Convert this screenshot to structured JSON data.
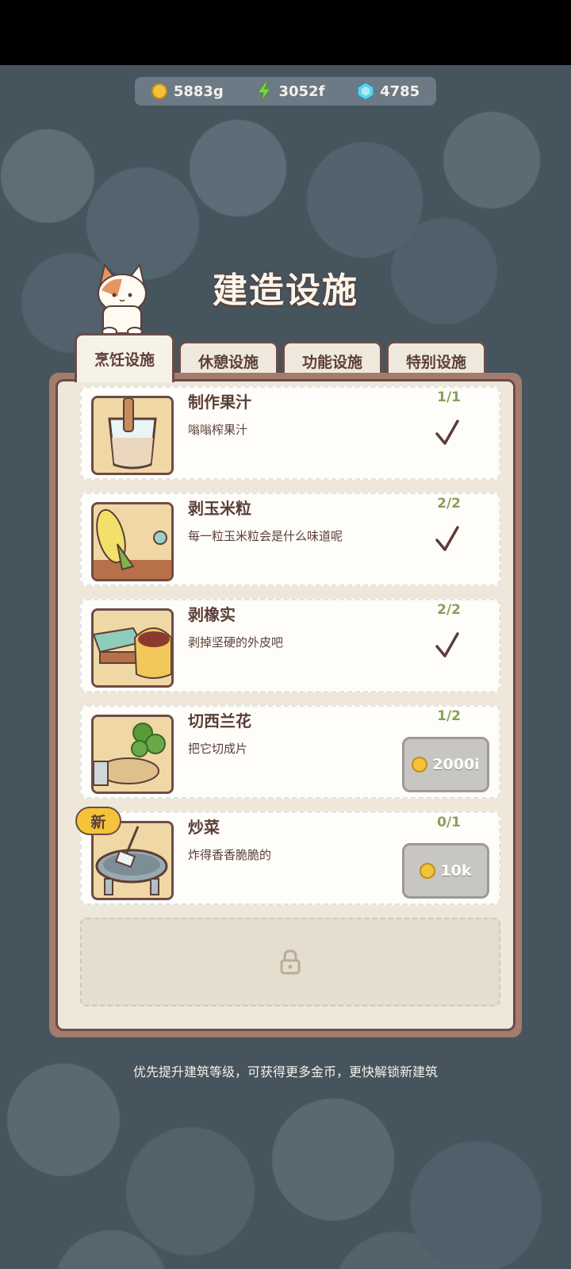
{
  "resources": {
    "gold": "5883g",
    "energy": "3052f",
    "gems": "4785"
  },
  "title": "建造设施",
  "tabs": [
    {
      "label": "烹饪设施",
      "active": true
    },
    {
      "label": "休憩设施",
      "active": false
    },
    {
      "label": "功能设施",
      "active": false
    },
    {
      "label": "特别设施",
      "active": false
    }
  ],
  "items": [
    {
      "title": "制作果汁",
      "desc": "嗡嗡榨果汁",
      "progress": "1/1",
      "state": "done"
    },
    {
      "title": "剥玉米粒",
      "desc": "每一粒玉米粒会是什么味道呢",
      "progress": "2/2",
      "state": "done"
    },
    {
      "title": "剥橡实",
      "desc": "剥掉坚硬的外皮吧",
      "progress": "2/2",
      "state": "done"
    },
    {
      "title": "切西兰花",
      "desc": "把它切成片",
      "progress": "1/2",
      "state": "buy",
      "price": "2000i"
    },
    {
      "title": "炒菜",
      "desc": "炸得香香脆脆的",
      "progress": "0/1",
      "state": "buy",
      "price": "10k",
      "badge": "新"
    }
  ],
  "tip": "优先提升建筑等级，可获得更多金币，更快解锁新建筑",
  "colors": {
    "accent_green": "#8aa05a",
    "panel_brown": "#6e4c45",
    "coin_gold": "#f2c23b"
  }
}
